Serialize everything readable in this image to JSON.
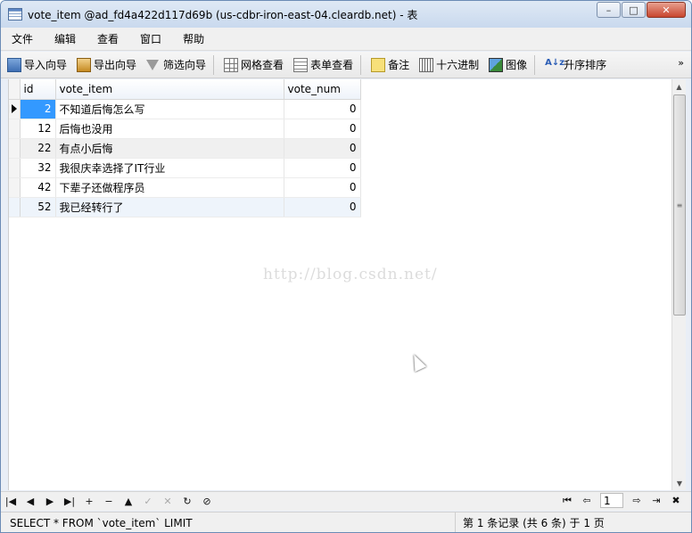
{
  "window": {
    "title": "vote_item @ad_fd4a422d117d69b (us-cdbr-iron-east-04.cleardb.net) - 表",
    "minimize": "–",
    "maximize": "□",
    "close": "✕"
  },
  "menu": [
    "文件",
    "编辑",
    "查看",
    "窗口",
    "帮助"
  ],
  "toolbar": {
    "import": "导入向导",
    "export": "导出向导",
    "filter": "筛选向导",
    "grid_view": "网格查看",
    "form_view": "表单查看",
    "memo": "备注",
    "hex": "十六进制",
    "image": "图像",
    "sort_asc": "升序排序",
    "more": "»"
  },
  "table": {
    "columns": [
      "id",
      "vote_item",
      "vote_num"
    ],
    "rows": [
      {
        "id": "2",
        "vote_item": "不知道后悔怎么写",
        "vote_num": "0"
      },
      {
        "id": "12",
        "vote_item": "后悔也没用",
        "vote_num": "0"
      },
      {
        "id": "22",
        "vote_item": "有点小后悔",
        "vote_num": "0"
      },
      {
        "id": "32",
        "vote_item": "我很庆幸选择了IT行业",
        "vote_num": "0"
      },
      {
        "id": "42",
        "vote_item": "下辈子还做程序员",
        "vote_num": "0"
      },
      {
        "id": "52",
        "vote_item": "我已经转行了",
        "vote_num": "0"
      }
    ]
  },
  "watermark": "http://blog.csdn.net/",
  "navigation": {
    "first": "|◀",
    "prev": "◀",
    "next": "▶",
    "last": "▶|",
    "add": "+",
    "delete": "−",
    "apply": "▲",
    "save": "✓",
    "cancel": "✕",
    "refresh": "↻",
    "stop": "⊘",
    "page_first": "⏮",
    "page_prev": "⇦",
    "page_value": "1",
    "page_next": "⇨",
    "page_last": "⇥",
    "settings": "✖"
  },
  "status": {
    "sql": "SELECT * FROM `vote_item` LIMIT",
    "page_info": "第 1 条记录 (共 6 条) 于 1 页"
  }
}
